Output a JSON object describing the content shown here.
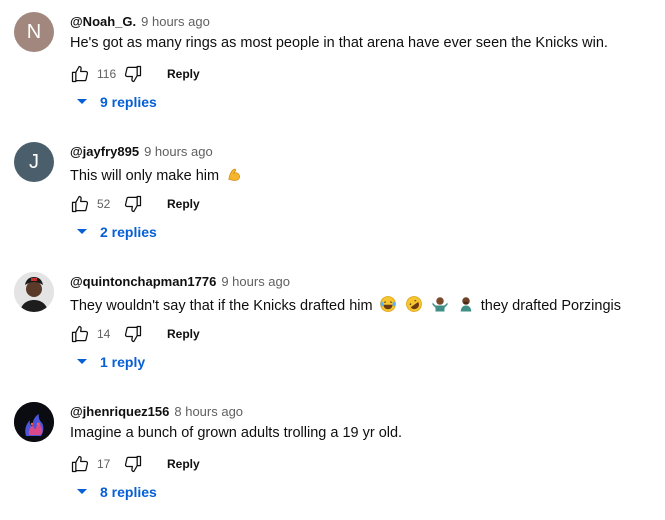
{
  "comments": [
    {
      "avatar_letter": "N",
      "avatar_color": "#a1877e",
      "author": "@Noah_G.",
      "time": "9 hours ago",
      "text": "He's got as many rings as most people in that arena have ever seen the Knicks win.",
      "likes": "116",
      "reply_label": "Reply",
      "replies_label": "9 replies"
    },
    {
      "avatar_letter": "J",
      "avatar_color": "#4b5e6b",
      "author": "@jayfry895",
      "time": "9 hours ago",
      "text": "This will only make him",
      "text_emojis": [
        "flexed-biceps"
      ],
      "likes": "52",
      "reply_label": "Reply",
      "replies_label": "2 replies"
    },
    {
      "avatar_letter": "",
      "avatar_color": "#d9d9d9",
      "author": "@quintonchapman1776",
      "time": "9 hours ago",
      "text": "They wouldn't say that if the Knicks drafted him",
      "text_emojis": [
        "tears-of-joy",
        "rolling-laughing",
        "person-shrugging",
        "man-facepalming"
      ],
      "text_after": "they drafted Porzingis",
      "likes": "14",
      "reply_label": "Reply",
      "replies_label": "1 reply"
    },
    {
      "avatar_letter": "",
      "avatar_color": "#0b0b12",
      "author": "@jhenriquez156",
      "time": "8 hours ago",
      "text": "Imagine a bunch of grown adults trolling a 19 yr old.",
      "likes": "17",
      "reply_label": "Reply",
      "replies_label": "8 replies"
    }
  ],
  "colors": {
    "link": "#065fd4",
    "meta": "#606060"
  }
}
